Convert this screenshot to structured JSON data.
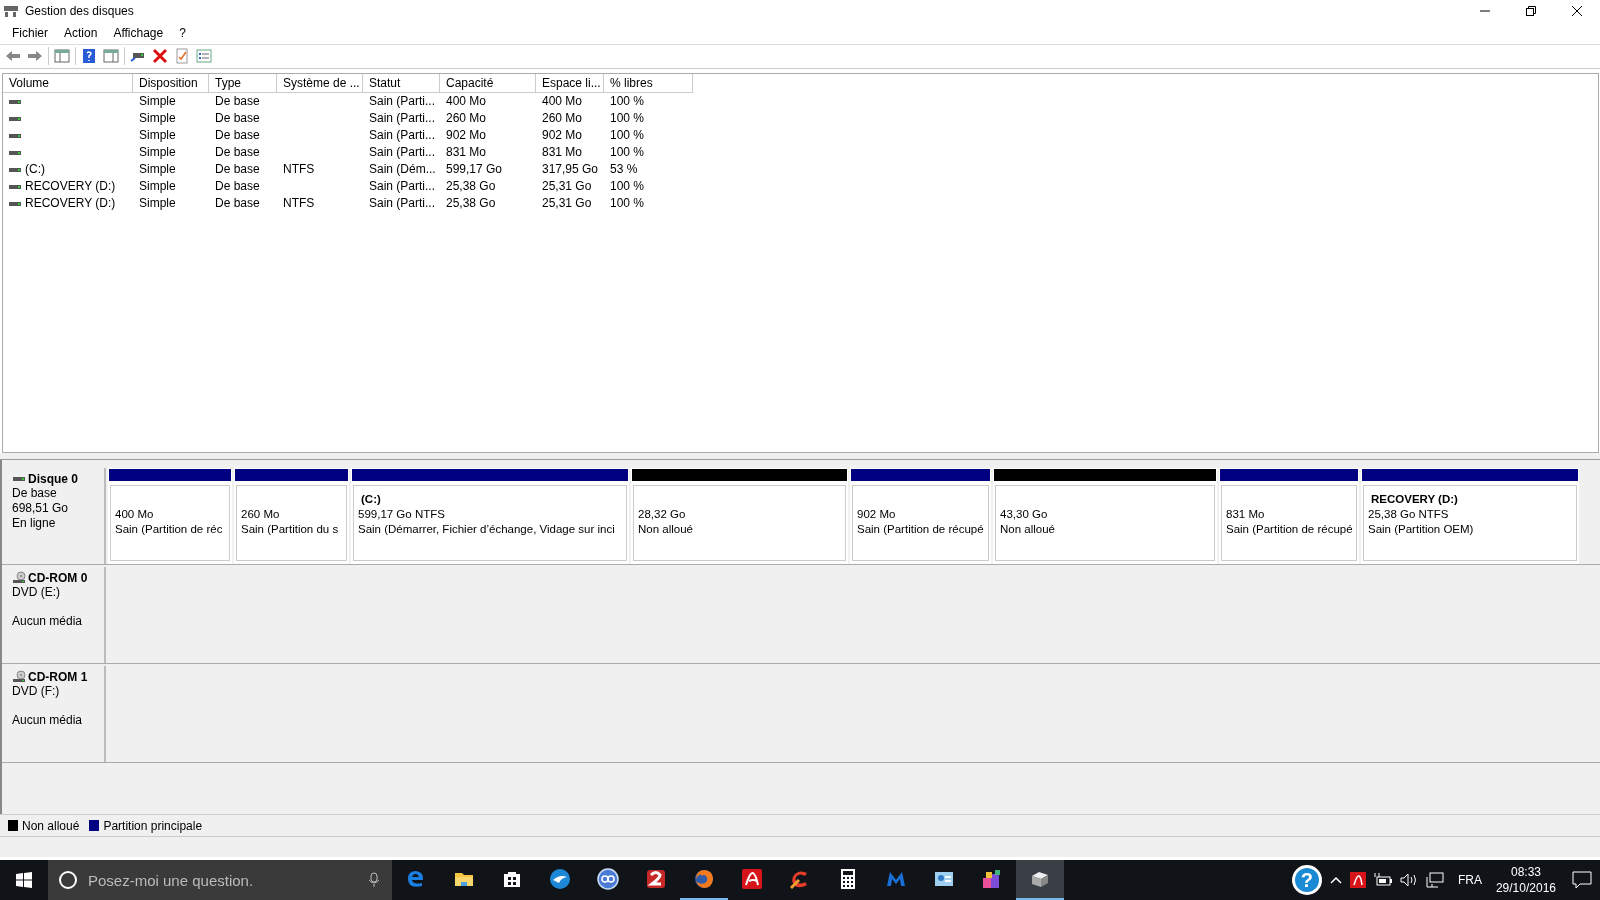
{
  "window": {
    "title": "Gestion des disques"
  },
  "menu": [
    "Fichier",
    "Action",
    "Affichage",
    "?"
  ],
  "toolbar": [
    {
      "kind": "back",
      "disabled": false
    },
    {
      "kind": "forward",
      "disabled": false
    },
    {
      "kind": "sep"
    },
    {
      "kind": "tree",
      "disabled": false
    },
    {
      "kind": "sep"
    },
    {
      "kind": "help",
      "disabled": false
    },
    {
      "kind": "pane",
      "disabled": false
    },
    {
      "kind": "sep"
    },
    {
      "kind": "connect",
      "disabled": false
    },
    {
      "kind": "delete",
      "disabled": false
    },
    {
      "kind": "check",
      "disabled": false
    },
    {
      "kind": "props",
      "disabled": false
    }
  ],
  "table": {
    "columns": [
      "Volume",
      "Disposition",
      "Type",
      "Système de ...",
      "Statut",
      "Capacité",
      "Espace li...",
      "% libres"
    ],
    "rows": [
      {
        "layout": "Simple",
        "type": "De base",
        "status": "Sain (Parti...",
        "capacity": "400 Mo",
        "free": "400 Mo",
        "pct": "100 %"
      },
      {
        "layout": "Simple",
        "type": "De base",
        "status": "Sain (Parti...",
        "capacity": "260 Mo",
        "free": "260 Mo",
        "pct": "100 %"
      },
      {
        "layout": "Simple",
        "type": "De base",
        "status": "Sain (Parti...",
        "capacity": "902 Mo",
        "free": "902 Mo",
        "pct": "100 %"
      },
      {
        "layout": "Simple",
        "type": "De base",
        "status": "Sain (Parti...",
        "capacity": "831 Mo",
        "free": "831 Mo",
        "pct": "100 %"
      },
      {
        "volume": "(C:)",
        "layout": "Simple",
        "type": "De base",
        "fs": "NTFS",
        "status": "Sain (Dém...",
        "capacity": "599,17 Go",
        "free": "317,95 Go",
        "pct": "53 %"
      },
      {
        "volume": "RECOVERY (D:)",
        "layout": "Simple",
        "type": "De base",
        "status": "Sain (Parti...",
        "capacity": "25,38 Go",
        "free": "25,31 Go",
        "pct": "100 %"
      },
      {
        "volume": "RECOVERY (D:)",
        "layout": "Simple",
        "type": "De base",
        "fs": "NTFS",
        "status": "Sain (Parti...",
        "capacity": "25,38 Go",
        "free": "25,31 Go",
        "pct": "100 %"
      }
    ]
  },
  "disks": [
    {
      "kind": "disk",
      "name": "Disque 0",
      "type": "De base",
      "size": "698,51 Go",
      "status": "En ligne",
      "partitions": [
        {
          "kind": "primary",
          "size": "400 Mo",
          "status": "Sain (Partition de réc"
        },
        {
          "kind": "primary",
          "size": "260 Mo",
          "status": "Sain (Partition du s"
        },
        {
          "kind": "primary",
          "title": "(C:)",
          "size": "599,17 Go NTFS",
          "status": "Sain (Démarrer, Fichier d’échange, Vidage sur inci"
        },
        {
          "kind": "unallocated",
          "size": "28,32 Go",
          "status": "Non alloué"
        },
        {
          "kind": "primary",
          "size": "902 Mo",
          "status": "Sain (Partition de récupé"
        },
        {
          "kind": "unallocated",
          "size": "43,30 Go",
          "status": "Non alloué"
        },
        {
          "kind": "primary",
          "size": "831 Mo",
          "status": "Sain (Partition de récupé"
        },
        {
          "kind": "primary",
          "title": "RECOVERY  (D:)",
          "size": "25,38 Go NTFS",
          "status": "Sain (Partition OEM)"
        }
      ]
    },
    {
      "kind": "cdrom",
      "name": "CD-ROM 0",
      "drive": "DVD (E:)",
      "status": "Aucun média"
    },
    {
      "kind": "cdrom",
      "name": "CD-ROM 1",
      "drive": "DVD (F:)",
      "status": "Aucun média"
    }
  ],
  "legend": [
    {
      "label": "Non alloué",
      "color": "#000000"
    },
    {
      "label": "Partition principale",
      "color": "#000080"
    }
  ],
  "taskbar": {
    "search": {
      "placeholder": "Posez-moi une question."
    },
    "apps": [
      {
        "kind": "edge",
        "active": false
      },
      {
        "kind": "folder",
        "active": false
      },
      {
        "kind": "store",
        "active": false
      },
      {
        "kind": "bird",
        "active": false
      },
      {
        "kind": "qb",
        "active": false
      },
      {
        "kind": "game",
        "active": false
      },
      {
        "kind": "firefox",
        "active": true
      },
      {
        "kind": "avira",
        "active": false
      },
      {
        "kind": "ccleaner",
        "active": false
      },
      {
        "kind": "calc",
        "active": false
      },
      {
        "kind": "mbam",
        "active": false
      },
      {
        "kind": "picture",
        "active": false
      },
      {
        "kind": "blocks",
        "active": false
      },
      {
        "kind": "disk",
        "active": true
      }
    ],
    "help": "?",
    "language": "FRA",
    "time": "08:33",
    "date": "29/10/2016"
  }
}
